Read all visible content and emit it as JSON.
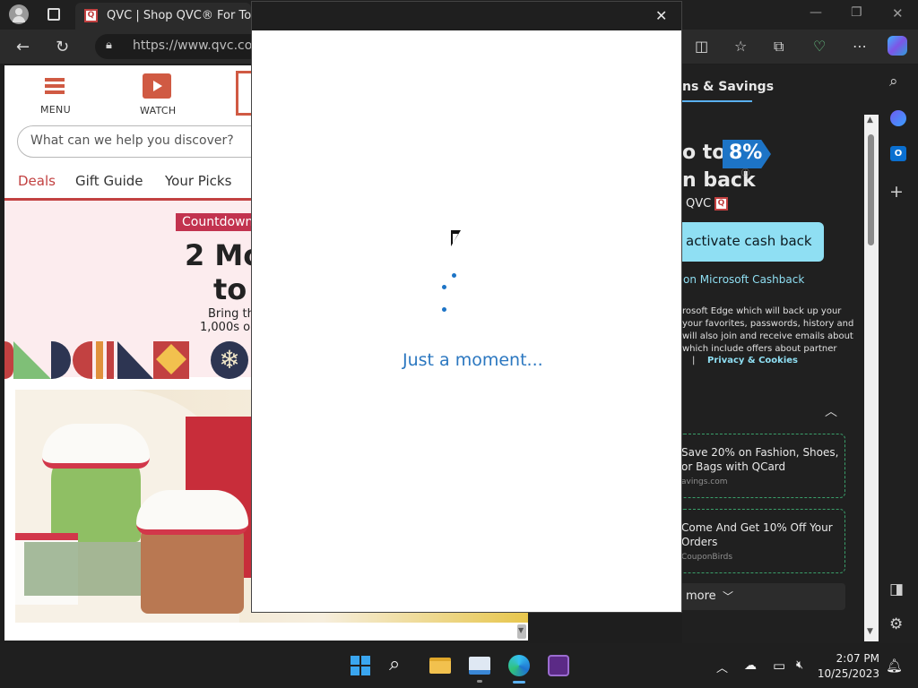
{
  "browser": {
    "tab_title": "QVC | Shop QVC® For Today's",
    "address_url": "https://www.qvc.com"
  },
  "qvc_page": {
    "menu_label": "MENU",
    "watch_label": "WATCH",
    "search_placeholder": "What can we help you discover?",
    "nav_links": [
      "Deals",
      "Gift Guide",
      "Your Picks"
    ],
    "countdown_badge": "Countdown",
    "hero_line1": "2 Mo",
    "hero_line2": "to",
    "hero_small1": "Bring th",
    "hero_small2": "1,000s o"
  },
  "dialog": {
    "loading_text": "Just a moment..."
  },
  "sidebar": {
    "header": "ns & Savings",
    "promo_line1": "o to",
    "promo_percent": "8%",
    "promo_line2": "n back",
    "promo_store": "QVC",
    "cashback_button": "activate cash back",
    "cashback_link": "on Microsoft Cashback",
    "disclaimer_lines": [
      "rosoft Edge which will back up your",
      "your favorites, passwords, history and",
      "will also join and receive emails about",
      "which include offers about partner"
    ],
    "privacy_link": "Privacy & Cookies",
    "separator": "|",
    "offers": [
      {
        "title": "Save 20% on Fashion, Shoes, or Bags with QCard",
        "source": "avings.com"
      },
      {
        "title": "Come And Get 10% Off Your Orders",
        "source": "CouponBirds"
      }
    ],
    "more_label": "more"
  },
  "taskbar": {
    "time": "2:07 PM",
    "date": "10/25/2023"
  },
  "colors": {
    "qvc_red": "#c24141",
    "edge_accent": "#1d74c6",
    "cashback_blue": "#8fdff3",
    "offer_border": "#3a9f6a"
  }
}
